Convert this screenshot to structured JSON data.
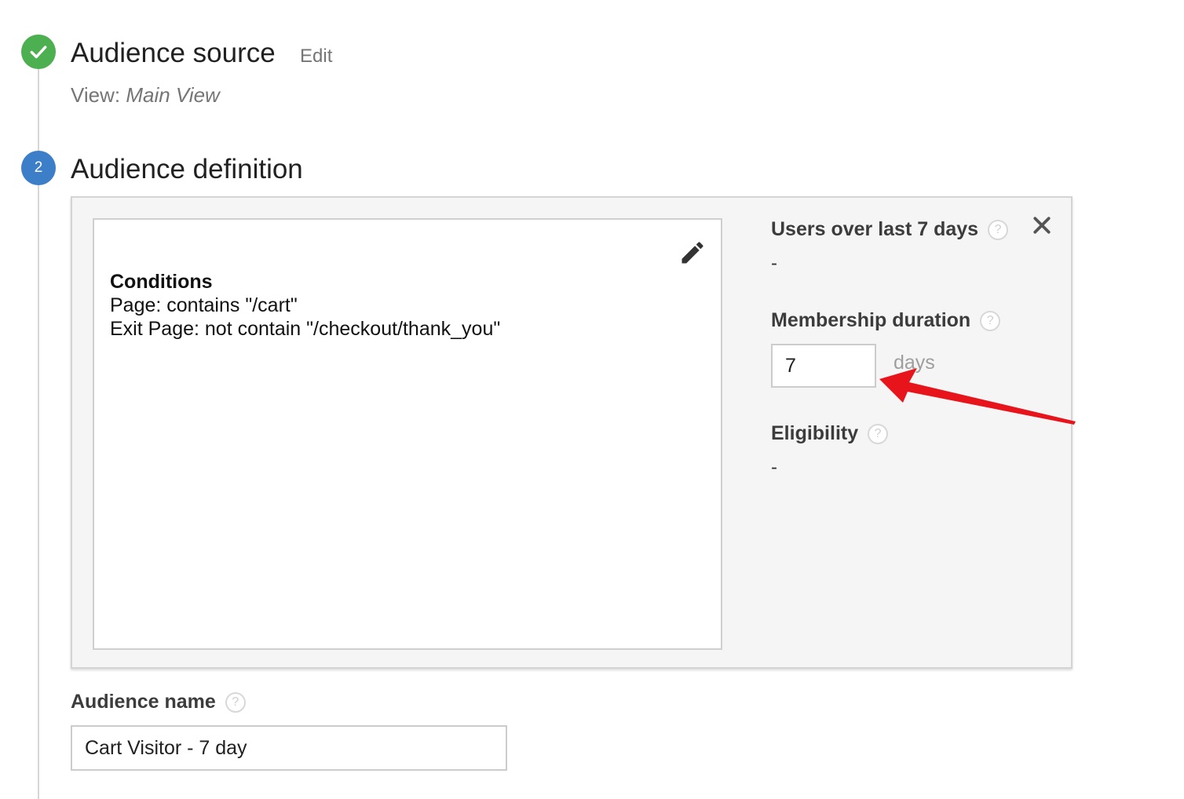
{
  "steps": {
    "source": {
      "number": "",
      "title": "Audience source",
      "edit_label": "Edit",
      "view_prefix": "View:",
      "view_value": "Main View",
      "status": "complete",
      "badge_color": "#4caf50"
    },
    "definition": {
      "number": "2",
      "title": "Audience definition",
      "status": "active",
      "badge_color": "#3d7ec8"
    }
  },
  "conditions": {
    "heading": "Conditions",
    "lines": [
      "Page: contains \"/cart\"",
      "Exit Page: not contain \"/checkout/thank_you\""
    ],
    "edit_icon": "pencil-icon"
  },
  "sidebar": {
    "users_label": "Users over last 7 days",
    "users_value": "-",
    "membership_label": "Membership duration",
    "membership_value": "7",
    "membership_unit": "days",
    "eligibility_label": "Eligibility",
    "eligibility_value": "-",
    "help_glyph": "?",
    "close_icon": "close-icon"
  },
  "audience_name": {
    "label": "Audience name",
    "value": "Cart Visitor - 7 day"
  },
  "colors": {
    "accent_blue": "#3d7ec8",
    "success_green": "#4caf50",
    "annotation_red": "#e8141b"
  }
}
